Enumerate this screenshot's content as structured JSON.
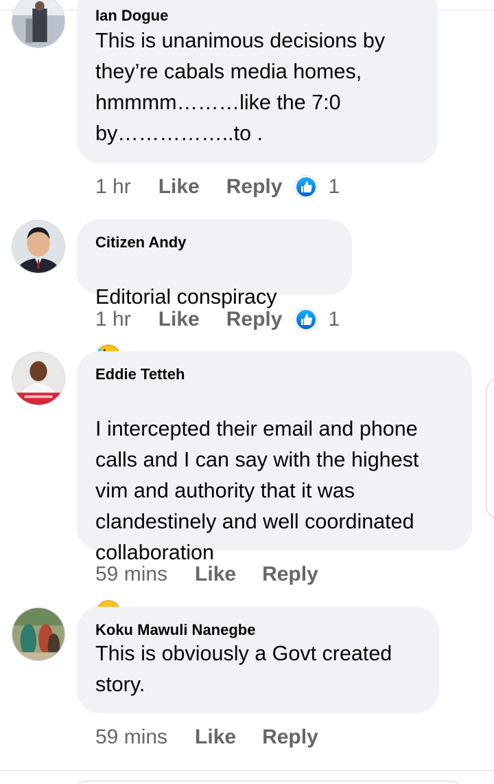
{
  "comments": [
    {
      "author": "Ian Dogue",
      "text": "This is unanimous decisions by\nthey’re cabals media homes,\nhmmmm………like the 7:0\nby……………..to .",
      "time": "1 hr",
      "like_label": "Like",
      "reply_label": "Reply",
      "reaction_icon": "thumbs-up-icon",
      "reaction_count": "1"
    },
    {
      "author": "Citizen Andy",
      "text": "Editorial conspiracy",
      "emoji": "rolling-laughing-emoji-icon",
      "time": "1 hr",
      "like_label": "Like",
      "reply_label": "Reply",
      "reaction_icon": "thumbs-up-icon",
      "reaction_count": "1"
    },
    {
      "author": "Eddie Tetteh",
      "text": "I intercepted their email and phone\ncalls and I can say with the highest\nvim and authority that it was\nclandestinely and well coordinated\ncollaboration",
      "emoji": "grinning-squint-emoji-icon",
      "time": "59 mins",
      "like_label": "Like",
      "reply_label": "Reply"
    },
    {
      "author": "Koku Mawuli Nanegbe",
      "text": "This is obviously a Govt created\nstory.",
      "time": "59 mins",
      "like_label": "Like",
      "reply_label": "Reply"
    }
  ],
  "colors": {
    "bubble": "#f0f2f5",
    "meta_text": "#65676b",
    "like_blue": "#0866ff"
  }
}
